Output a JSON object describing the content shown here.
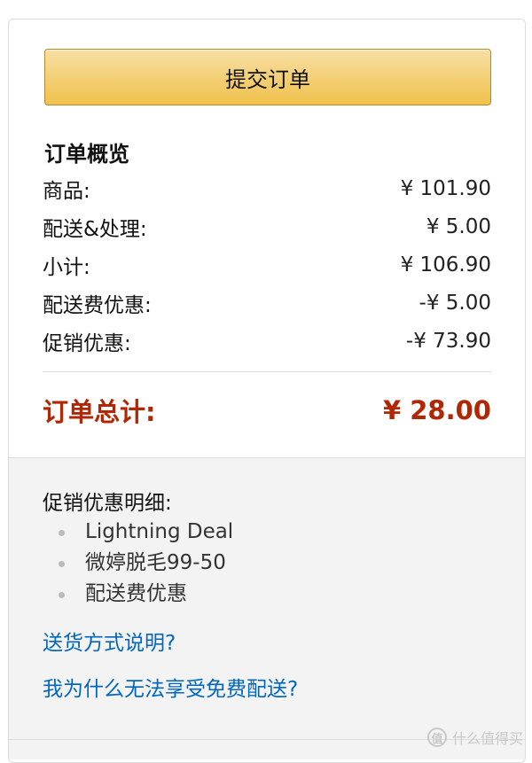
{
  "place_order": {
    "label": "提交订单"
  },
  "order_summary": {
    "title": "订单概览",
    "rows": [
      {
        "label": "商品:",
        "value": "¥ 101.90"
      },
      {
        "label": "配送&处理:",
        "value": "¥ 5.00"
      },
      {
        "label": "小计:",
        "value": "¥ 106.90"
      },
      {
        "label": "配送费优惠:",
        "value": "-¥ 5.00"
      },
      {
        "label": "促销优惠:",
        "value": "-¥ 73.90"
      }
    ],
    "total": {
      "label": "订单总计:",
      "value": "¥ 28.00"
    }
  },
  "promotions": {
    "title": "促销优惠明细:",
    "items": [
      "Lightning Deal",
      "微婷脱毛99-50",
      "配送费优惠"
    ]
  },
  "links": {
    "shipping_info": "送货方式说明?",
    "why_no_free_shipping": "我为什么无法享受免费配送?"
  },
  "watermark": {
    "text": "什么值得买",
    "icon_letter": "值"
  },
  "colors": {
    "total_red": "#b12704",
    "link_blue": "#0066c0",
    "button_gold": "#f0c14b"
  }
}
